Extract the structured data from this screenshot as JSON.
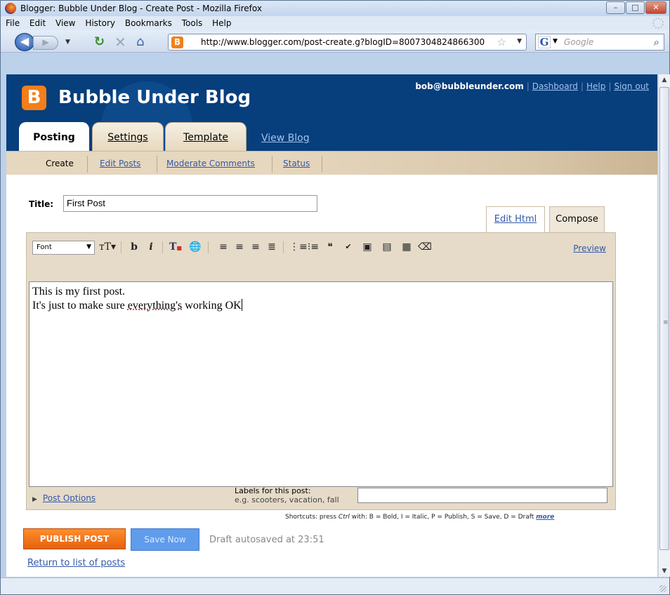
{
  "window": {
    "title": "Blogger: Bubble Under Blog - Create Post - Mozilla Firefox",
    "controls": {
      "minimize": "–",
      "maximize": "□",
      "close": "✕"
    }
  },
  "menu": [
    "File",
    "Edit",
    "View",
    "History",
    "Bookmarks",
    "Tools",
    "Help"
  ],
  "nav": {
    "url": "http://www.blogger.com/post-create.g?blogID=8007304824866300",
    "search_placeholder": "Google",
    "favicon_letter": "B",
    "search_engine_letter": "G",
    "icons": [
      "back-icon",
      "forward-icon",
      "reload-icon",
      "stop-icon",
      "home-icon",
      "bookmark-star-icon",
      "search-icon"
    ]
  },
  "blog": {
    "logo_letter": "B",
    "title": "Bubble Under Blog",
    "user_email": "bob@bubbleunder.com",
    "user_links": [
      "Dashboard",
      "Help",
      "Sign out"
    ],
    "tabs": [
      "Posting",
      "Settings",
      "Template"
    ],
    "view_blog": "View Blog",
    "subnav": [
      "Create",
      "Edit Posts",
      "Moderate Comments",
      "Status"
    ],
    "brand_color": "#073e7c",
    "accent_color": "#f37f1a"
  },
  "editor": {
    "title_label": "Title:",
    "title_value": "First Post",
    "mode_tabs": {
      "edit_html": "Edit Html",
      "compose": "Compose"
    },
    "font_select": "Font",
    "preview": "Preview",
    "body_line1": "This is my first post.",
    "body_line2_before": "It's just to make sure ",
    "body_line2_misspelled": "everything's",
    "body_line2_after": " working OK",
    "post_options": "Post Options",
    "labels_title": "Labels for this post:",
    "labels_example": "e.g. scooters, vacation, fall",
    "labels_value": ""
  },
  "shortcuts": {
    "prefix": "Shortcuts: press ",
    "ctrl": "Ctrl",
    "middle": " with: ",
    "text": "B = Bold, I = Italic, P = Publish, S = Save, D = Draft ",
    "more": "more"
  },
  "actions": {
    "publish": "PUBLISH POST",
    "save": "Save Now",
    "autosave_status": "Draft autosaved at 23:51",
    "return_link": "Return to list of posts"
  }
}
